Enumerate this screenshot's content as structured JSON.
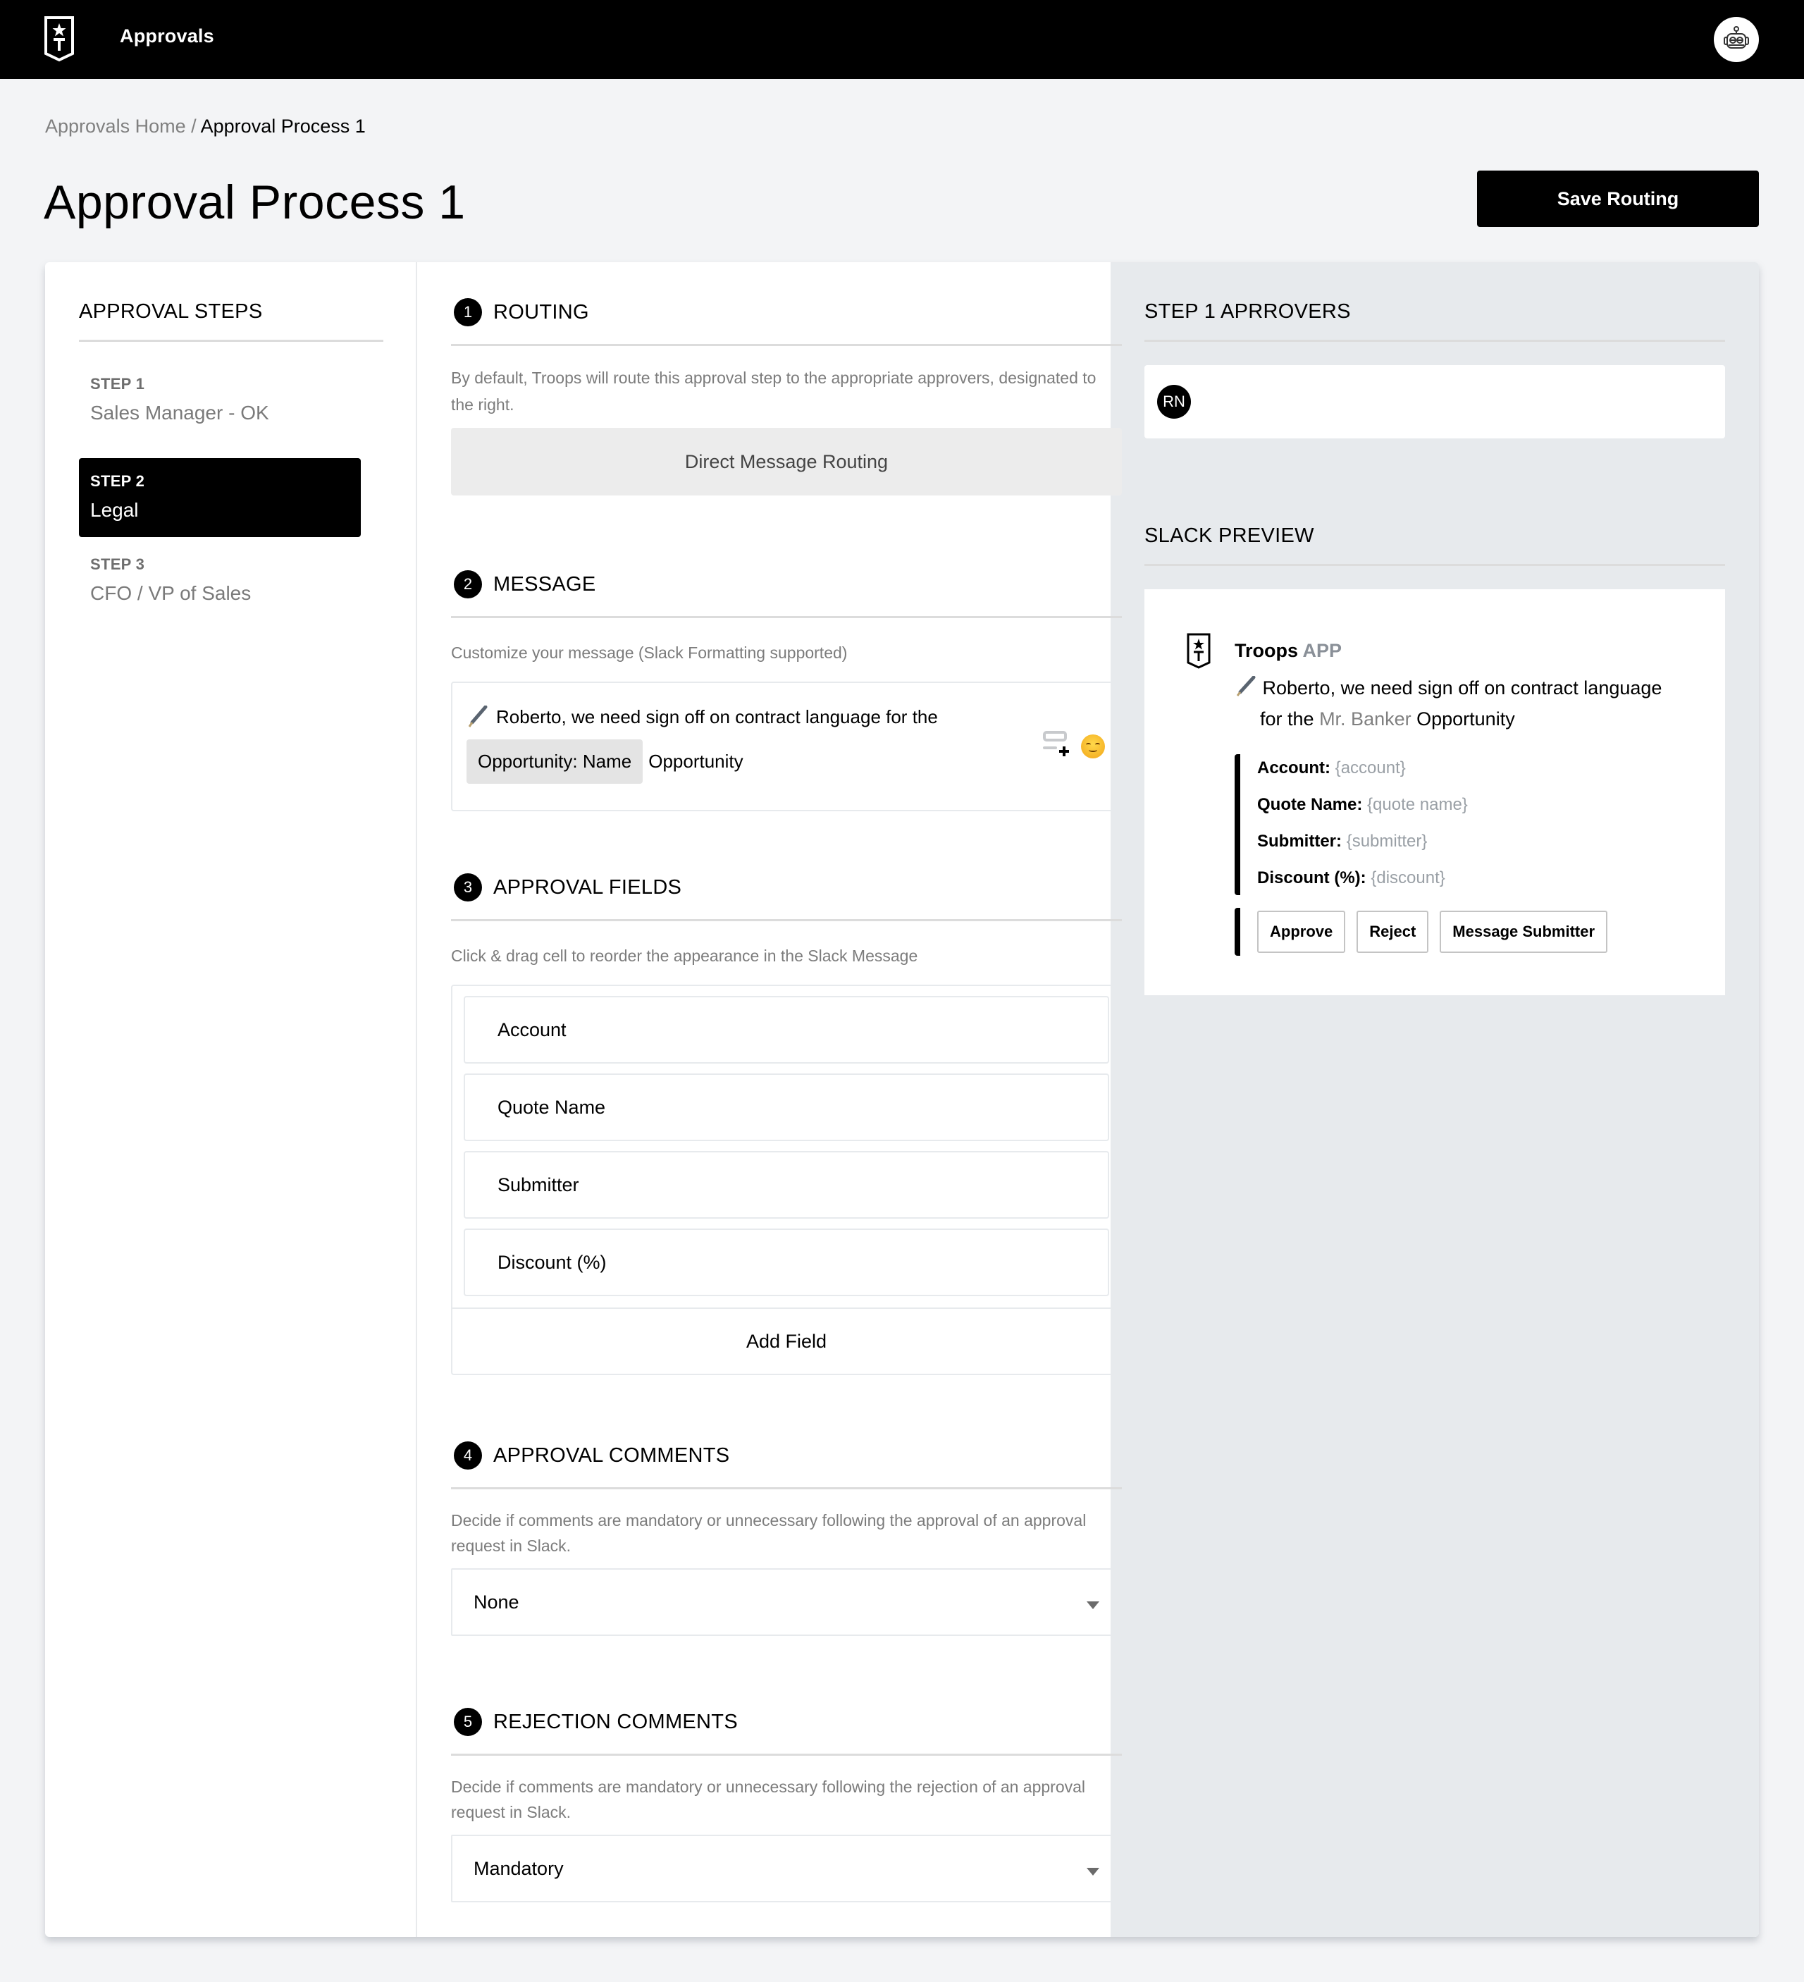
{
  "topbar": {
    "app_title": "Approvals",
    "logo_icon": "troops-shield-logo",
    "avatar_icon": "robot-avatar"
  },
  "breadcrumb": {
    "home": "Approvals Home",
    "separator": "/",
    "current": "Approval Process 1"
  },
  "page": {
    "title": "Approval Process 1",
    "save_label": "Save Routing"
  },
  "steps": {
    "heading": "APPROVAL STEPS",
    "items": [
      {
        "number": "STEP 1",
        "name": "Sales Manager - OK",
        "active": false
      },
      {
        "number": "STEP 2",
        "name": "Legal",
        "active": true
      },
      {
        "number": "STEP 3",
        "name": "CFO / VP of Sales",
        "active": false
      }
    ]
  },
  "routing": {
    "badge": "1",
    "heading": "ROUTING",
    "help": "By default, Troops will route this approval step to the appropriate approvers, designated to the right.",
    "option_label": "Direct Message Routing"
  },
  "message": {
    "badge": "2",
    "heading": "MESSAGE",
    "help": "Customize your message (Slack Formatting supported)",
    "prefix_icon": "fountain-pen-emoji",
    "text_line1": "Roberto, we need sign off on contract language for the",
    "token": "Opportunity: Name",
    "text_line2": "Opportunity",
    "insert_field_icon": "insert-field-icon",
    "emoji_icon": "smiling-face-emoji"
  },
  "approval_fields": {
    "badge": "3",
    "heading": "APPROVAL FIELDS",
    "help": "Click & drag cell to reorder the appearance in the Slack Message",
    "fields": [
      "Account",
      "Quote Name",
      "Submitter",
      "Discount (%)"
    ],
    "add_label": "Add Field"
  },
  "approval_comments": {
    "badge": "4",
    "heading": "APPROVAL COMMENTS",
    "help": "Decide if comments are mandatory or unnecessary following the approval of an approval request in Slack.",
    "selected": "None"
  },
  "rejection_comments": {
    "badge": "5",
    "heading": "REJECTION COMMENTS",
    "help": "Decide if comments are mandatory or unnecessary following the rejection of an approval request in Slack.",
    "selected": "Mandatory"
  },
  "approvers": {
    "heading": "STEP 1 APRROVERS",
    "list": [
      {
        "initials": "RN"
      }
    ]
  },
  "slack_preview": {
    "heading": "SLACK PREVIEW",
    "sender": "Troops",
    "sender_tag": "APP",
    "text_line1": "Roberto, we need sign off on contract language",
    "text_pre": "for the",
    "text_var": "Mr. Banker",
    "text_post": "Opportunity",
    "fields": [
      {
        "label": "Account:",
        "value": "{account}"
      },
      {
        "label": "Quote Name:",
        "value": "{quote name}"
      },
      {
        "label": "Submitter:",
        "value": "{submitter}"
      },
      {
        "label": "Discount (%):",
        "value": "{discount}"
      }
    ],
    "buttons": [
      "Approve",
      "Reject",
      "Message Submitter"
    ]
  },
  "colors": {
    "topbar_bg": "#000000",
    "page_bg": "#f3f4f6",
    "preview_bg": "#e7eaed",
    "accent": "#000000",
    "muted_text": "#7c7c7c"
  }
}
